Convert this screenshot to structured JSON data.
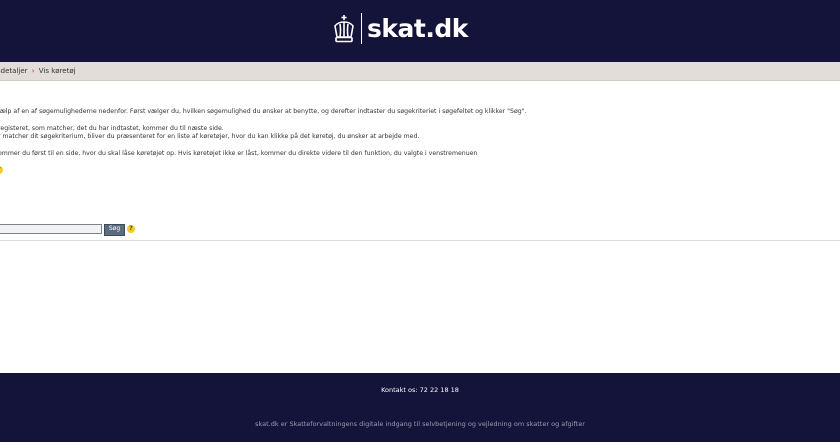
{
  "header": {
    "logo_text": "skat.dk",
    "logo_icon": "crown-icon",
    "brand_color": "#14143a"
  },
  "breadcrumb": {
    "item_1": "sdetaljer",
    "separator": "›",
    "item_2": "Vis køretøj"
  },
  "intro": {
    "line_1": "jælp af en af søgemulighederne nedenfor. Først vælger du, hvilken søgemulighed du ønsker at benytte, og derefter indtaster du søgekriteriet i søgefeltet og klikker \"Søg\".",
    "line_2": "registeret, som matcher, det du har indtastet, kommer du til næste side.",
    "line_3": "r matcher dit søgekriterium, bliver du præsenteret for en liste af køretøjer, hvor du kan klikke på det køretøj, du ønsker at arbejde med.",
    "line_4": "ommer du først til en side, hvor du skal låse køretøjet op. Hvis køretøjet ikke er låst, kommer du direkte videre til den funktion, du valgte i venstremenuen"
  },
  "search": {
    "value": "",
    "button_label": "Søg",
    "help_icon": "help-icon",
    "help_glyph": "?"
  },
  "footer": {
    "contact": "Kontakt os:  72 22 18 18",
    "tagline": "skat.dk er Skatteforvaltningens digitale indgang til selvbetjening og vejledning om skatter og afgifter"
  }
}
